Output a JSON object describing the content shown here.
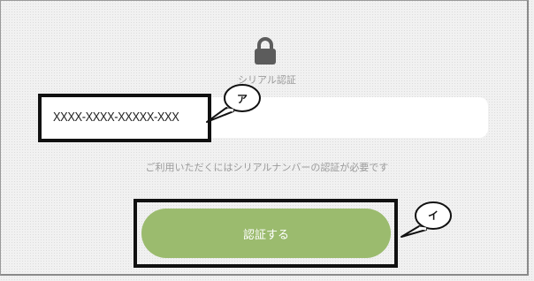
{
  "auth": {
    "title": "シリアル認証",
    "serial_value": "XXXX-XXXX-XXXXX-XXX",
    "hint": "ご利用いただくにはシリアルナンバーの認証が必要です",
    "submit_label": "認証する"
  },
  "annotations": {
    "a_label": "ア",
    "i_label": "イ"
  },
  "colors": {
    "button": "#9bbb6e",
    "lock": "#5c5c5c",
    "muted_text": "#9a9a9a"
  },
  "icons": {
    "lock": "lock-icon"
  }
}
